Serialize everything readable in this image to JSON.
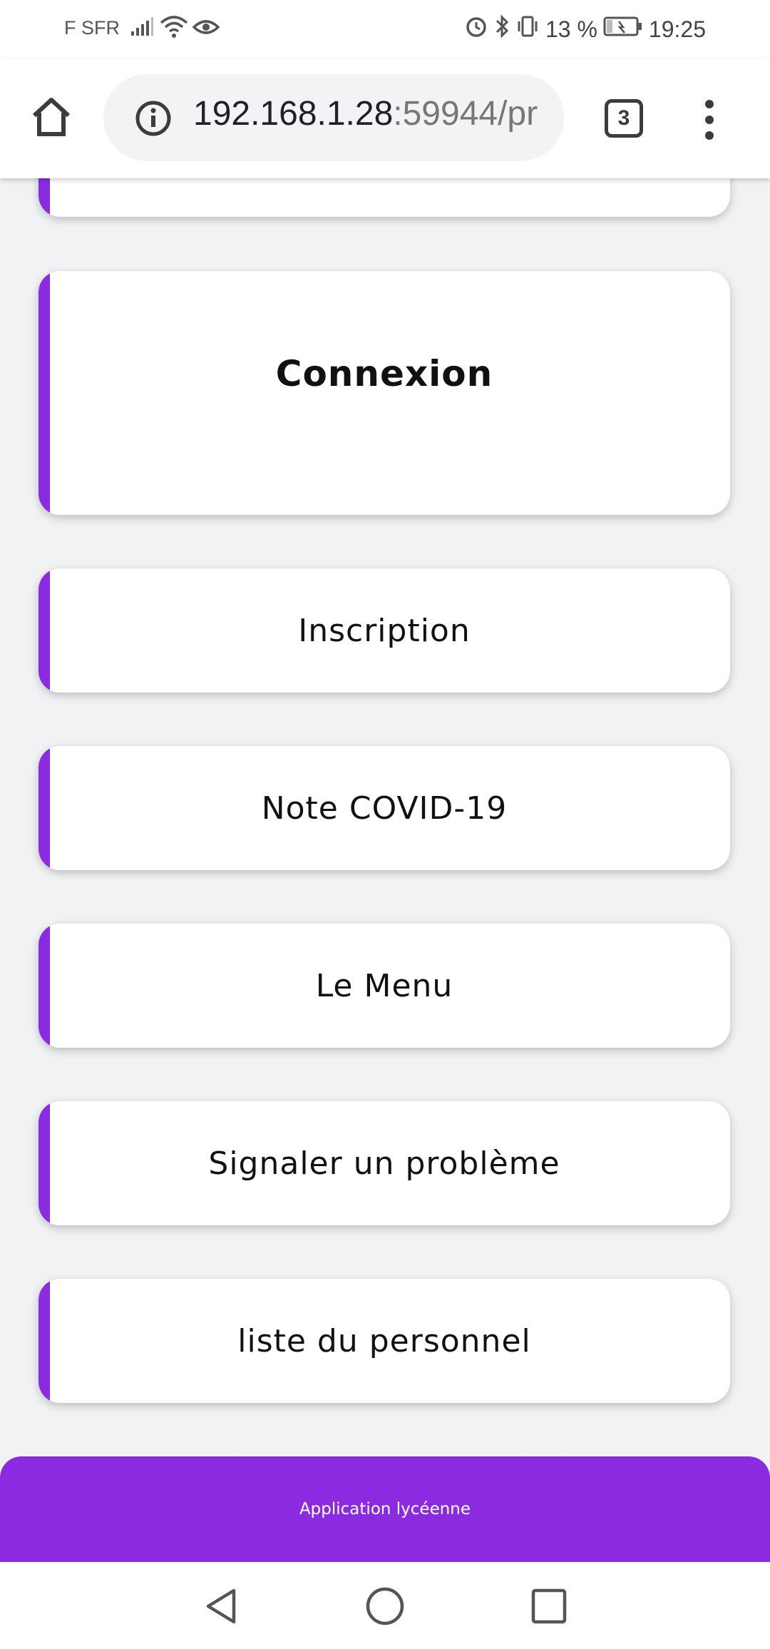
{
  "status_bar": {
    "carrier": "F SFR",
    "battery": "13 %",
    "time": "19:25"
  },
  "browser": {
    "url_host": "192.168.1.28",
    "url_rest": ":59944/pr",
    "tab_count": "3"
  },
  "menu": {
    "connexion": "Connexion",
    "items": [
      "Inscription",
      "Note COVID-19",
      "Le Menu",
      "Signaler un problème",
      "liste du personnel"
    ]
  },
  "footer": {
    "text": "Application lycéenne"
  },
  "colors": {
    "accent": "#8a2be2",
    "background": "#f1f2f4"
  }
}
